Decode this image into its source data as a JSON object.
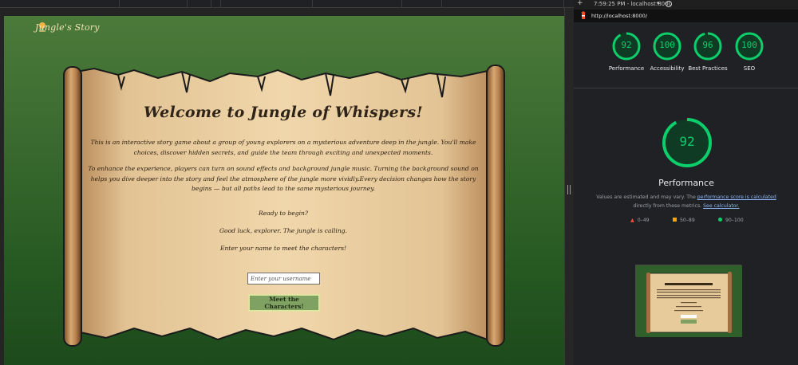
{
  "game": {
    "logo_text": "Jungle's Story",
    "title": "Welcome to Jungle of Whispers!",
    "paragraph_1": "This is an interactive story game about a group of young explorers on a mysterious adventure deep in the jungle. You'll make choices, discover hidden secrets, and guide the team through exciting and unexpected moments.",
    "paragraph_2": "To enhance the experience, players can turn on sound effects and background jungle music. Turning the background sound on helps you dive deeper into the story and feel the atmosphere of the jungle more vividly.Every decision changes how the story begins — but all paths lead to the same mysterious journey.",
    "ready": "Ready to begin?",
    "good_luck": "Good luck, explorer. The jungle is calling.",
    "enter_name": "Enter your name to meet the characters!",
    "username_placeholder": "Enter your username",
    "meet_button": "Meet the Characters!"
  },
  "lighthouse": {
    "time": "7:59:25 PM - localhost:8000",
    "url": "http://localhost:8000/",
    "scores": [
      {
        "value": "92",
        "label": "Performance"
      },
      {
        "value": "100",
        "label": "Accessibility"
      },
      {
        "value": "96",
        "label": "Best Practices"
      },
      {
        "value": "100",
        "label": "SEO"
      }
    ],
    "performance_value": "92",
    "performance_title": "Performance",
    "note_prefix": "Values are estimated and may vary. The ",
    "note_link": "performance score is calculated",
    "note_middle": " directly from these metrics. ",
    "note_link2": "See calculator.",
    "legend": [
      "0–49",
      "50–89",
      "90–100"
    ],
    "colors": {
      "good": "#0cce6b",
      "average": "#ffa400",
      "poor": "#ff4e42"
    }
  }
}
